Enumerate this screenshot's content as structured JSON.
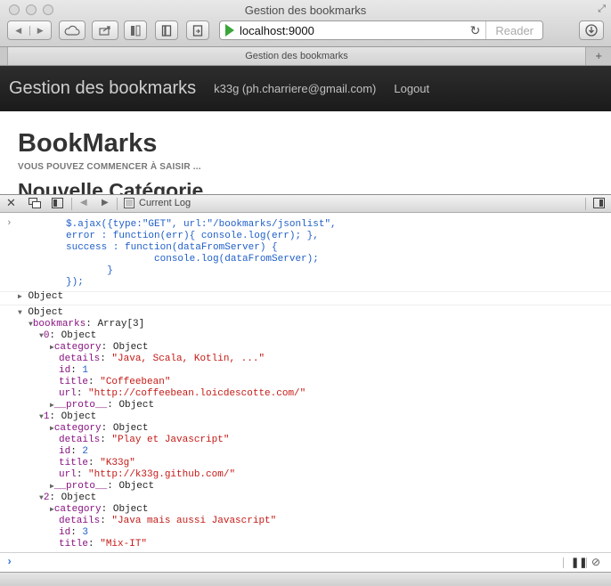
{
  "window": {
    "title": "Gestion des bookmarks",
    "tab_title": "Gestion des bookmarks"
  },
  "toolbar": {
    "url": "localhost:9000",
    "reader_label": "Reader"
  },
  "navbar": {
    "brand": "Gestion des bookmarks",
    "user": "k33g (ph.charriere@gmail.com)",
    "logout": "Logout"
  },
  "page": {
    "title": "BookMarks",
    "subtitle": "VOUS POUVEZ COMMENCER À SAISIR ...",
    "section": "Nouvelle Catégorie"
  },
  "inspector": {
    "current_log_label": "Current Log"
  },
  "console": {
    "code": [
      "$.ajax({type:\"GET\", url:\"/bookmarks/jsonlist\",",
      "error : function(err){ console.log(err); },",
      "success : function(dataFromServer) {",
      "               console.log(dataFromServer);",
      "       }",
      "});"
    ],
    "object_label": "Object",
    "bookmarks_key": "bookmarks",
    "bookmarks_type": "Array[3]",
    "items": [
      {
        "index": "0",
        "id": "1",
        "details": "\"Java, Scala, Kotlin, ...\"",
        "title": "\"Coffeebean\"",
        "url": "\"http://coffeebean.loicdescotte.com/\""
      },
      {
        "index": "1",
        "id": "2",
        "details": "\"Play et Javascript\"",
        "title": "\"K33g\"",
        "url": "\"http://k33g.github.com/\""
      },
      {
        "index": "2",
        "id": "3",
        "details": "\"Java mais aussi Javascript\"",
        "title": "\"Mix-IT\"",
        "url": ""
      }
    ],
    "labels": {
      "category": "category",
      "details": "details",
      "id": "id",
      "title": "title",
      "url": "url",
      "proto": "__proto__"
    }
  }
}
